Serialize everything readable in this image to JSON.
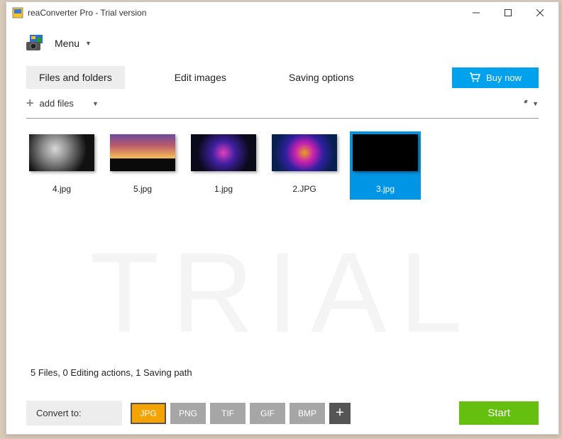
{
  "titlebar": {
    "title": "reaConverter Pro - Trial version"
  },
  "menubar": {
    "menu_label": "Menu"
  },
  "tabs": {
    "files": "Files and folders",
    "edit": "Edit images",
    "saving": "Saving options"
  },
  "buy_now": "Buy now",
  "toolbar": {
    "add_files": "add files"
  },
  "trial_watermark": "TRIAL",
  "thumbnails": [
    {
      "label": "4.jpg"
    },
    {
      "label": "5.jpg"
    },
    {
      "label": "1.jpg"
    },
    {
      "label": "2.JPG"
    },
    {
      "label": "3.jpg"
    }
  ],
  "status": "5 Files,  0 Editing actions,  1 Saving path",
  "convert_to_label": "Convert to:",
  "formats": {
    "jpg": "JPG",
    "png": "PNG",
    "tif": "TIF",
    "gif": "GIF",
    "bmp": "BMP"
  },
  "start_label": "Start"
}
